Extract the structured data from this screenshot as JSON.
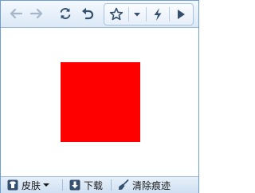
{
  "toolbar": {
    "buttons": [
      {
        "icon": "back-arrow-icon",
        "enabled": false
      },
      {
        "icon": "forward-arrow-icon",
        "enabled": false
      },
      {
        "icon": "refresh-icon",
        "enabled": true
      },
      {
        "icon": "undo-icon",
        "enabled": true
      },
      {
        "icon": "star-icon",
        "enabled": true
      },
      {
        "icon": "chevron-down-icon",
        "enabled": true
      },
      {
        "icon": "lightning-icon",
        "enabled": true
      },
      {
        "icon": "play-icon",
        "enabled": true
      }
    ],
    "icon_color": "#35506f",
    "disabled_color": "#a7b7c9"
  },
  "content": {
    "shape_color": "#ff0000"
  },
  "statusbar": {
    "skin_label": "皮肤",
    "download_label": "下载",
    "clear_traces_label": "清除痕迹"
  }
}
